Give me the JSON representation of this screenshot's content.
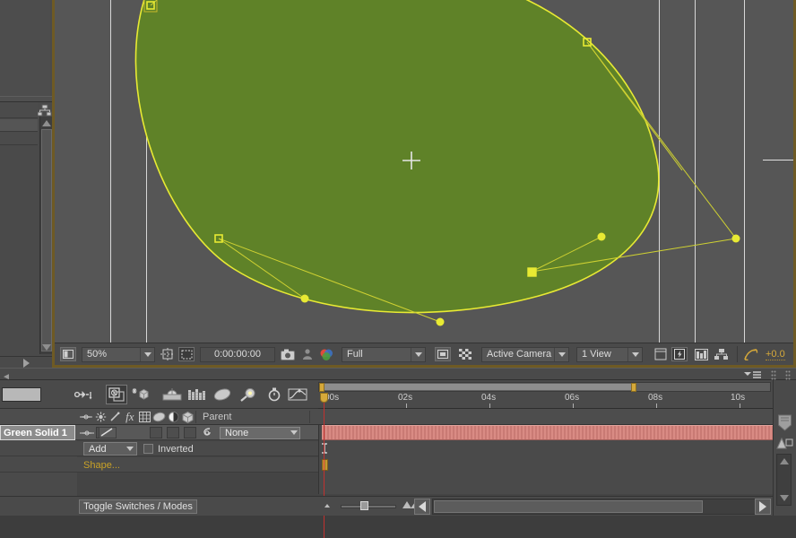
{
  "viewer": {
    "zoom_level": "50%",
    "timecode": "0:00:00:00",
    "resolution": "Full",
    "camera": "Active Camera",
    "views": "1 View",
    "exposure": "+0.0",
    "solid_color": "#5f8228",
    "mask_stroke_color": "#e8ea33",
    "guide_color": "#d7d7d7",
    "icons": {
      "region_of_interest": "always-preview-this-view-icon",
      "transparency_grid": "toggle-transparency-grid-icon",
      "mask_visibility": "toggle-mask-and-shape-path-visibility-icon",
      "snapshot": "take-snapshot-icon",
      "show_snapshot": "show-snapshot-icon",
      "channel": "show-channel-and-color-management-icon",
      "guides": "choose-grid-and-guide-options-icon",
      "roi": "region-of-interest-icon",
      "timecode_toggle": "toggle-pixel-aspect-ratio-correction-icon",
      "fast_previews": "fast-previews-icon",
      "timeline_btn": "timeline-icon",
      "comp_flowchart": "comp-flowchart-icon",
      "exposure": "adjust-exposure-icon"
    }
  },
  "timeline": {
    "search_placeholder": "",
    "search_value": "",
    "toolbar_icons": [
      "composition-mini-flowchart-icon",
      "draft-3d-icon",
      "hide-shy-layers-icon",
      "enable-frame-blending-icon",
      "enable-motion-blur-icon",
      "graph-editor-brainstorm-icon",
      "auto-keyframe-icon",
      "graph-editor-icon"
    ],
    "column_switch_icons": [
      "video-switch-icon",
      "solo-switch-icon",
      "lock-switch-icon",
      "shy-switch-icon",
      "effects-switch-icon",
      "frame-blend-switch-icon",
      "motion-blur-switch-icon",
      "adjustment-layer-switch-icon",
      "3d-layer-switch-icon"
    ],
    "parent_header": "Parent",
    "toggle_switches_label": "Toggle Switches / Modes",
    "ruler": {
      "ticks": [
        "00s",
        "02s",
        "04s",
        "06s",
        "08s",
        "10s"
      ],
      "tick_positions": [
        0,
        88,
        181,
        274,
        367,
        459
      ]
    },
    "playhead_time": "0s",
    "layer": {
      "name": "Green Solid 1",
      "parent_value": "None",
      "bar_color": "#d98b84"
    },
    "mask": {
      "mode": "Add",
      "inverted_label": "Inverted",
      "inverted_checked": false,
      "shape_label": "Shape..."
    }
  },
  "panel_left": {
    "tree_icon": "comp-flowchart-icon",
    "expand_arrow_icon": "expand-panel-arrow-icon"
  },
  "colors": {
    "panel_bg": "#4a4a4a",
    "viewer_bg": "#565656",
    "accent_orange": "#d6a93a",
    "highlight_border": "#6e5a24",
    "cti_red": "#c1312f"
  },
  "chart_data": null
}
